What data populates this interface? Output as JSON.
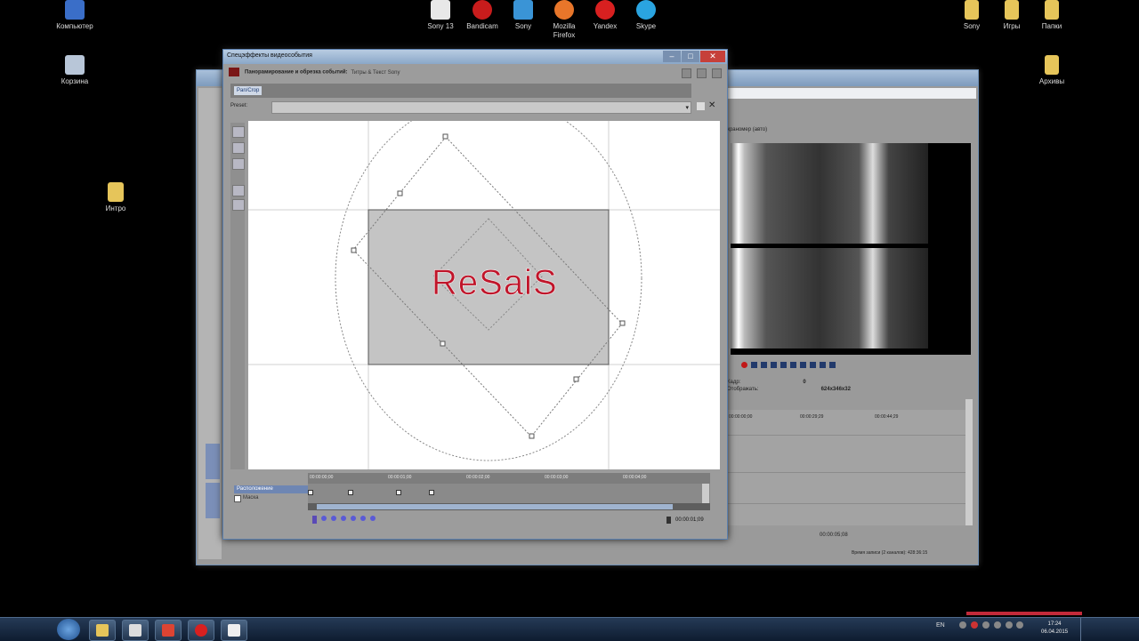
{
  "desktop": {
    "icons": [
      {
        "label": "Компьютер",
        "icon": "computer-icon",
        "color": "#3a6ec8"
      },
      {
        "label": "Корзина",
        "icon": "recycle-bin-icon",
        "color": "#b8c6d8"
      },
      {
        "label": "Интро",
        "icon": "folder-icon",
        "color": "#e6c55a"
      },
      {
        "label": "Sony 13",
        "icon": "sony-vegas-icon",
        "color": "#e8e8e8"
      },
      {
        "label": "Bandicam",
        "icon": "bandicam-icon",
        "color": "#c81c1c"
      },
      {
        "label": "Sony",
        "icon": "sony-icon",
        "color": "#3a94d6"
      },
      {
        "label": "Mozilla Firefox",
        "icon": "firefox-icon",
        "color": "#e8762a"
      },
      {
        "label": "Yandex",
        "icon": "yandex-icon",
        "color": "#d82020"
      },
      {
        "label": "Skype",
        "icon": "skype-icon",
        "color": "#2aa4e0"
      },
      {
        "label": "Sony",
        "icon": "folder-icon",
        "color": "#e6c55a"
      },
      {
        "label": "Игры",
        "icon": "folder-icon",
        "color": "#e6c55a"
      },
      {
        "label": "Папки",
        "icon": "folder-icon",
        "color": "#e6c55a"
      },
      {
        "label": "Архивы",
        "icon": "folder-icon",
        "color": "#e6c55a"
      }
    ]
  },
  "fx_window": {
    "title": "Спецэффекты видеособытия",
    "min": "–",
    "max": "□",
    "close": "✕",
    "chain_active": "Панорамирование и обрезка событий:",
    "chain_other": "Титры & Текст Sony",
    "tab": "Pan/Crop",
    "preset_label": "Preset:",
    "preset_dropdown": "▾",
    "preset_delete": "✕",
    "watermark_text": "ReSaiS",
    "ruler_ticks": [
      "00:00:00;00",
      "00:00:01;00",
      "00:00:02;00",
      "00:00:03;00",
      "00:00:04;00"
    ],
    "track_position": "Расположение",
    "track_mask": "Маска",
    "keyframes": [
      0,
      0.1,
      0.22,
      0.3
    ],
    "time": "00:00:01;09"
  },
  "vegas": {
    "preview_label": "Экраномер (авто)",
    "info_frame_label": "Кадр:",
    "info_frame_value": "0",
    "info_display_label": "Отображать:",
    "info_display_value": "624x346x32",
    "timeline_ticks": [
      "00:00:00;00",
      "00:00:29;29",
      "00:00:44;29"
    ],
    "status_time": "00:00:05;08",
    "footer": "Время записи (2 каналов): 428:36:15"
  },
  "taskbar": {
    "lang": "EN",
    "time": "17:24",
    "date": "06.04.2015",
    "tasks": [
      {
        "icon": "explorer-icon",
        "color": "#e6c55a"
      },
      {
        "icon": "app-icon",
        "color": "#ddd"
      },
      {
        "icon": "pdf-icon",
        "color": "#d43"
      },
      {
        "icon": "yandex-icon",
        "color": "#d82020"
      },
      {
        "icon": "vegas-icon",
        "color": "#eee"
      }
    ]
  }
}
